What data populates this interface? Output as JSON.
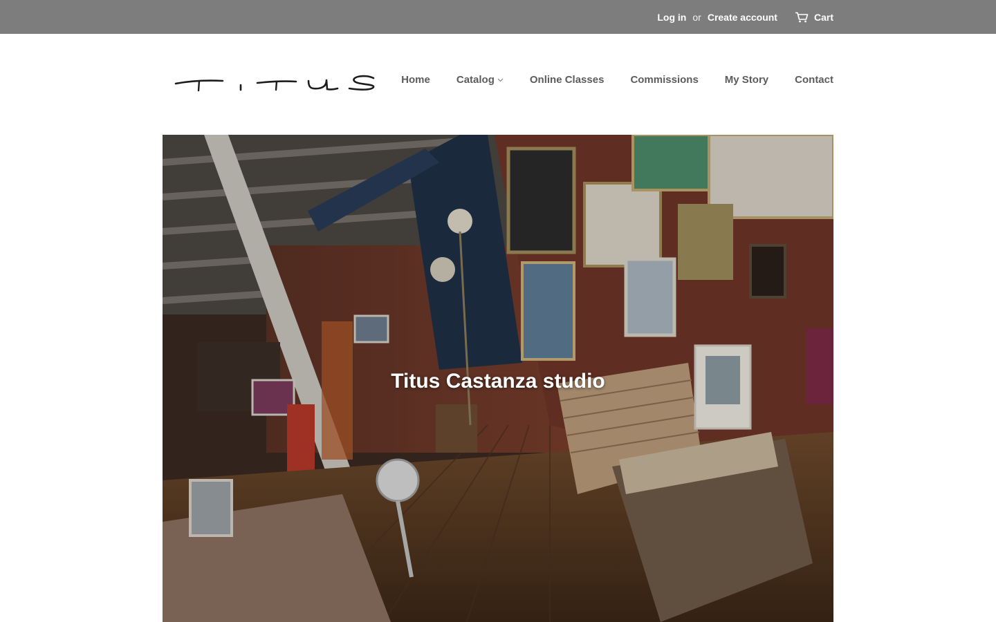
{
  "topbar": {
    "login_label": "Log in",
    "or_label": "or",
    "create_account_label": "Create account",
    "cart_label": "Cart",
    "cart_icon": "cart-icon",
    "background_color": "#7d7d7d"
  },
  "brand": {
    "logo_text": "TITUS"
  },
  "nav": {
    "items": [
      {
        "label": "Home"
      },
      {
        "label": "Catalog",
        "has_dropdown": true,
        "icon": "chevron-down-icon"
      },
      {
        "label": "Online Classes"
      },
      {
        "label": "Commissions"
      },
      {
        "label": "My Story"
      },
      {
        "label": "Contact"
      }
    ],
    "text_color": "#5c5c5c"
  },
  "hero": {
    "title": "Titus Castanza studio",
    "image": "art-studio-interior-photo"
  }
}
